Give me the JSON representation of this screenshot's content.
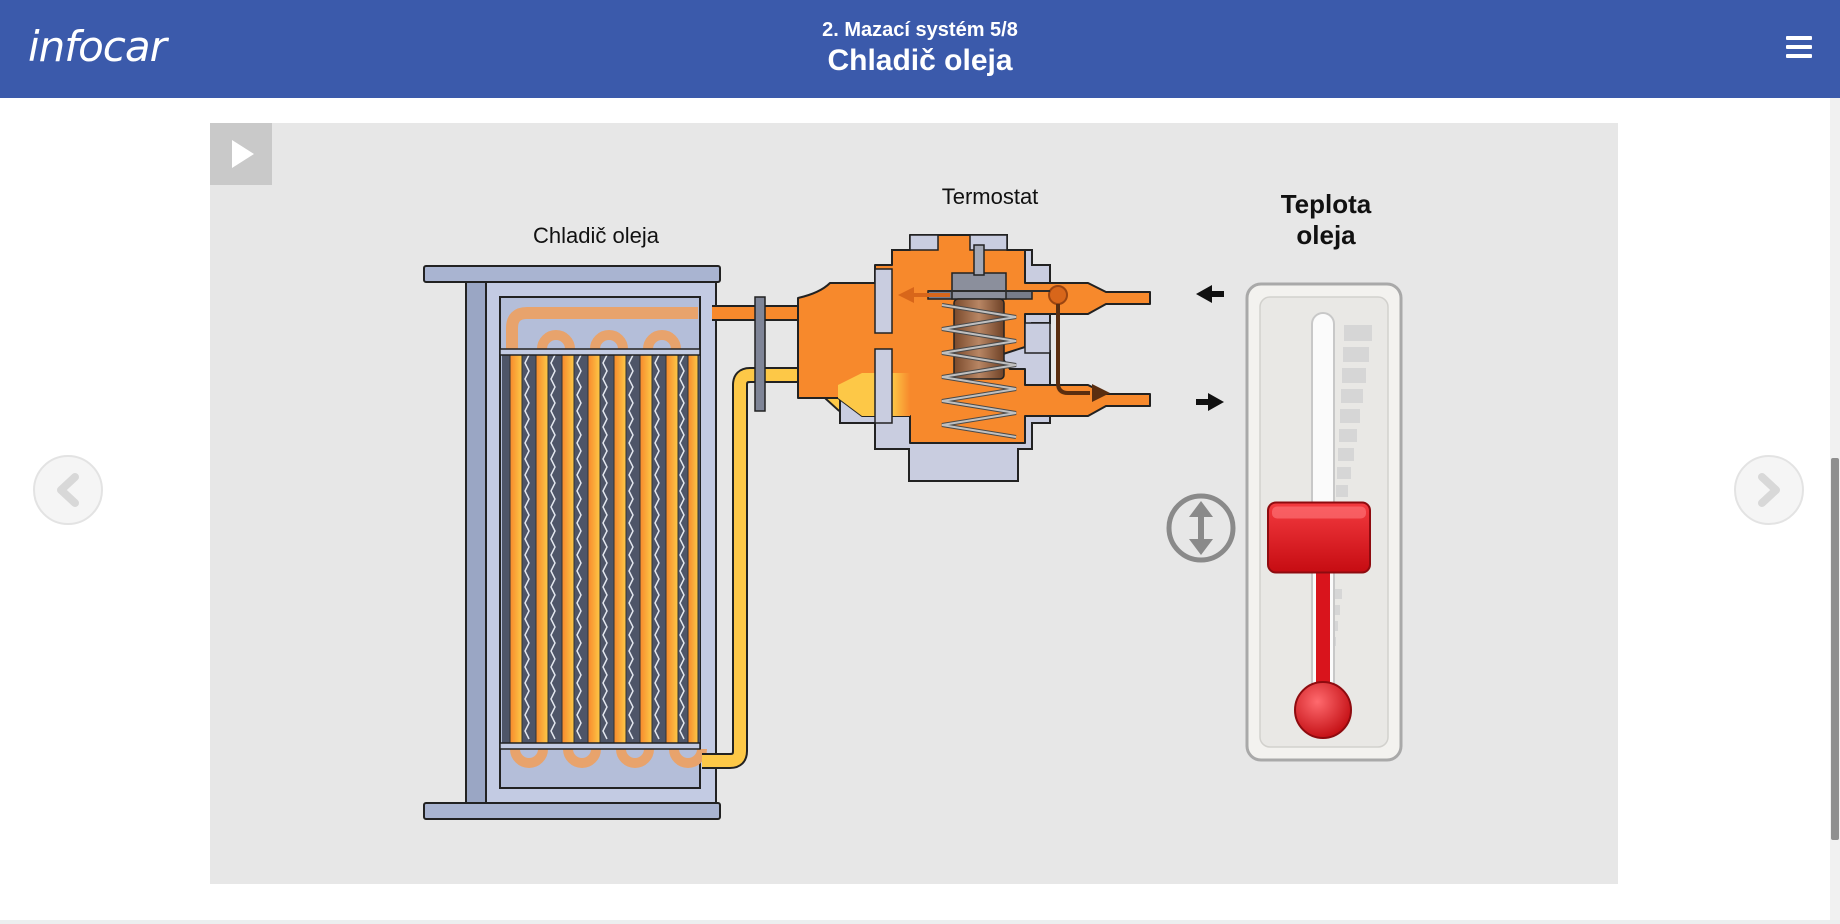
{
  "app": {
    "logo": "infocar"
  },
  "header": {
    "subtitle": "2. Mazací systém 5/8",
    "title": "Chladič oleja"
  },
  "diagram": {
    "cooler_label": "Chladič oleja",
    "thermostat_label": "Termostat",
    "temp_label_line1": "Teplota",
    "temp_label_line2": "oleja"
  },
  "icons": {
    "menu": "hamburger-icon",
    "play": "play-icon",
    "prev": "chevron-left-icon",
    "next": "chevron-right-icon",
    "drag": "up-down-arrow-icon"
  },
  "colors": {
    "header": "#3b5aab",
    "oil_hot": "#f7892c",
    "oil_warm": "#fdc847",
    "thermometer": "#e0141c"
  },
  "thermometer": {
    "level_percent": 45
  }
}
